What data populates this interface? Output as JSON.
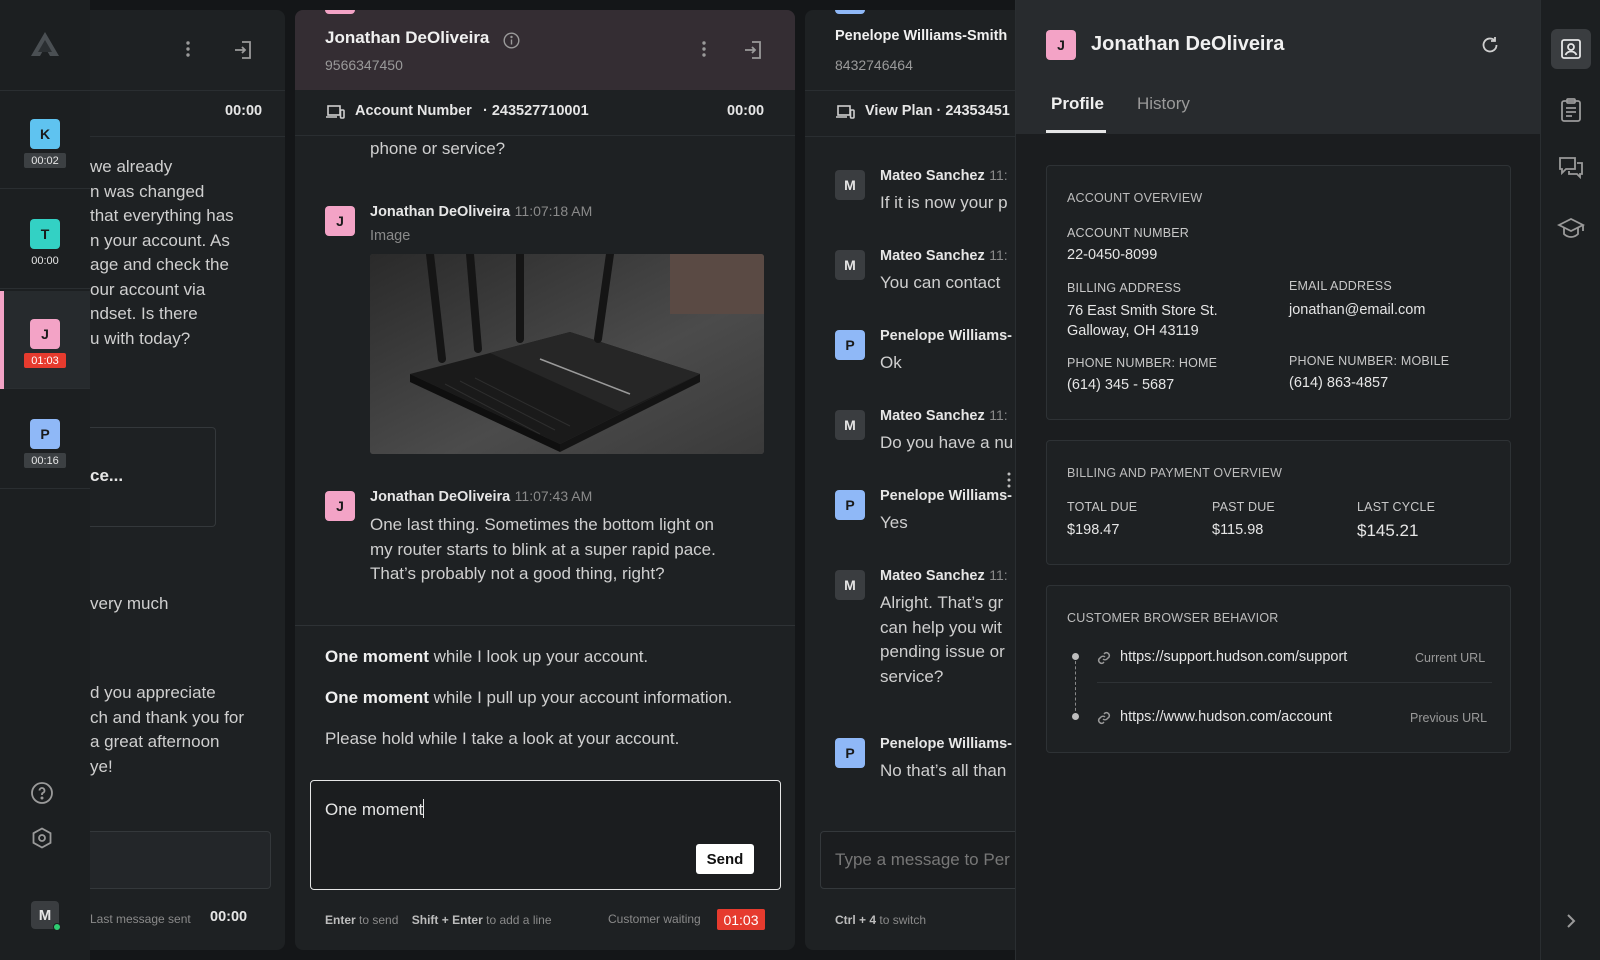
{
  "rail": {
    "chats": [
      {
        "initial": "K",
        "time": "00:02",
        "color": "#5fc3f0"
      },
      {
        "initial": "T",
        "time": "00:00",
        "color": "#33d1c4"
      },
      {
        "initial": "J",
        "time": "01:03",
        "color": "#f3a3c6"
      },
      {
        "initial": "P",
        "time": "00:16",
        "color": "#8fb8f7"
      }
    ],
    "user_initial": "M"
  },
  "panel1": {
    "timer": "00:00",
    "lines": [
      "we already",
      "n was changed",
      " that everything has",
      "n your account. As",
      "age and check the",
      "our account via",
      "ndset. Is there",
      "u with today?"
    ],
    "card_text": "ce...",
    "line_very": "very much",
    "lines2": [
      "d you appreciate",
      "ch and thank you for",
      "a great afternoon",
      "ye!"
    ],
    "footer_label": "Last message sent",
    "footer_time": "00:00"
  },
  "panel2": {
    "name": "Jonathan DeOliveira",
    "phone": "9566347450",
    "sub_label": "Account Number",
    "sub_value": "· 243527710001",
    "timer": "00:00",
    "prev_text": "phone or service?",
    "msg1": {
      "initial": "J",
      "name": "Jonathan DeOliveira",
      "time": "11:07:18 AM",
      "label": "Image"
    },
    "msg2": {
      "initial": "J",
      "name": "Jonathan DeOliveira",
      "time": "11:07:43 AM",
      "lines": [
        "One last thing. Sometimes the bottom light on",
        "my router starts to blink at a super rapid pace.",
        "That’s probably not a good thing, right?"
      ]
    },
    "suggestions": [
      {
        "bold": "One moment",
        "rest": " while I look up your account."
      },
      {
        "bold": "One moment",
        "rest": " while I pull up your account information."
      },
      {
        "bold": "",
        "rest": "Please hold while I take a look at your account."
      }
    ],
    "input_value": "One moment",
    "send_label": "Send",
    "hint_enter": "Enter",
    "hint_enter_text": "to send",
    "hint_shift": "Shift + Enter",
    "hint_shift_text": "to add a line",
    "waiting_label": "Customer waiting",
    "waiting_time": "01:03"
  },
  "panel3": {
    "name": "Penelope Williams-Smith",
    "phone": "8432746464",
    "sub_label": "View Plan",
    "sub_value": "· 24353451",
    "messages": [
      {
        "initial": "M",
        "name": "Mateo Sanchez",
        "time": "11:",
        "lines": [
          "If it is now your p"
        ],
        "color": "#3a3d40"
      },
      {
        "initial": "M",
        "name": "Mateo Sanchez",
        "time": "11:",
        "lines": [
          "You can contact"
        ],
        "color": "#3a3d40"
      },
      {
        "initial": "P",
        "name": "Penelope Williams-",
        "time": "",
        "lines": [
          "Ok"
        ],
        "color": "#8fb8f7"
      },
      {
        "initial": "M",
        "name": "Mateo Sanchez",
        "time": "11:",
        "lines": [
          "Do you have a nu"
        ],
        "color": "#3a3d40"
      },
      {
        "initial": "P",
        "name": "Penelope Williams-",
        "time": "",
        "lines": [
          "Yes"
        ],
        "color": "#8fb8f7"
      },
      {
        "initial": "M",
        "name": "Mateo Sanchez",
        "time": "11:",
        "lines": [
          "Alright. That’s gr",
          "can help you wit",
          "pending issue or",
          "service?"
        ],
        "color": "#3a3d40"
      },
      {
        "initial": "P",
        "name": "Penelope Williams-",
        "time": "",
        "lines": [
          "No that’s all than"
        ],
        "color": "#8fb8f7"
      }
    ],
    "input_placeholder": "Type a message to Per",
    "hint_key": "Ctrl + 4",
    "hint_text": "to switch"
  },
  "profile": {
    "initial": "J",
    "name": "Jonathan DeOliveira",
    "tabs": [
      "Profile",
      "History"
    ],
    "account_overview": {
      "title": "ACCOUNT OVERVIEW",
      "account_number_label": "ACCOUNT NUMBER",
      "account_number": "22-0450-8099",
      "billing_label": "BILLING ADDRESS",
      "billing_line1": "76 East Smith Store St.",
      "billing_line2": "Galloway, OH 43119",
      "email_label": "EMAIL ADDRESS",
      "email": "jonathan@email.com",
      "home_label": "PHONE NUMBER: HOME",
      "home": "(614) 345 - 5687",
      "mobile_label": "PHONE NUMBER: MOBILE",
      "mobile": "(614) 863-4857"
    },
    "billing": {
      "title": "BILLING AND PAYMENT OVERVIEW",
      "total_due_label": "TOTAL DUE",
      "total_due": "$198.47",
      "past_due_label": "PAST DUE",
      "past_due": "$115.98",
      "last_cycle_label": "LAST CYCLE",
      "last_cycle": "$145.21"
    },
    "browser": {
      "title": "CUSTOMER BROWSER BEHAVIOR",
      "urls": [
        {
          "url": "https://support.hudson.com/support",
          "tag": "Current URL"
        },
        {
          "url": "https://www.hudson.com/account",
          "tag": "Previous URL"
        }
      ]
    }
  },
  "colors": {
    "accent_red": "#e63b2e",
    "pink": "#f3a3c6"
  }
}
